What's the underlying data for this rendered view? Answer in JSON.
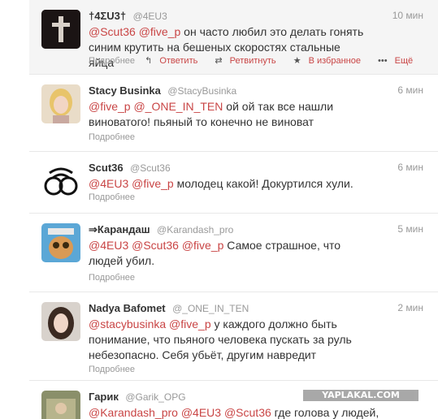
{
  "tweets": [
    {
      "name": "†4ΣU3†",
      "handle": "@4EU3",
      "time": "10 мин",
      "mentions": [
        "@Scut36",
        "@five_p"
      ],
      "text": "он часто любил это делать гонять синим крутить на бешеных скоростях стальные яйца",
      "more": "Подробнее",
      "actions": {
        "reply": "Ответить",
        "retweet": "Ретвитнуть",
        "favorite": "В избранное",
        "extra": "Ещё"
      }
    },
    {
      "name": "Stacy Businka",
      "handle": "@StacyBusinka",
      "time": "6 мин",
      "mentions": [
        "@five_p",
        "@_ONE_IN_TEN"
      ],
      "text": "ой ой так все нашли виноватого! пьяный то конечно не виноват",
      "more": "Подробнее"
    },
    {
      "name": "Scut36",
      "handle": "@Scut36",
      "time": "6 мин",
      "mentions": [
        "@4EU3",
        "@five_p"
      ],
      "text": "молодец какой! Докуртился хули.",
      "more": "Подробнее"
    },
    {
      "name": "⇒Карандаш",
      "handle": "@Karandash_pro",
      "time": "5 мин",
      "mentions": [
        "@4EU3",
        "@Scut36",
        "@five_p"
      ],
      "text": "Самое страшное, что людей убил.",
      "more": "Подробнее"
    },
    {
      "name": "Nadya Bafomet",
      "handle": "@_ONE_IN_TEN",
      "time": "2 мин",
      "mentions": [
        "@stacybusinka",
        "@five_p"
      ],
      "text": "у каждого должно быть понимание, что пьяного человека пускать за руль небезопасно. Себя убьёт, другим навредит",
      "more": "Подробнее"
    },
    {
      "name": "Гарик",
      "handle": "@Garik_OPG",
      "time": "",
      "mentions": [
        "@Karandash_pro",
        "@4EU3",
        "@Scut36"
      ],
      "text": " где голова у людей,",
      "more": ""
    }
  ],
  "watermark": "YAPLAKAL.COM",
  "colors": {
    "mention": "#c94545",
    "muted": "#999999",
    "text": "#333333"
  }
}
